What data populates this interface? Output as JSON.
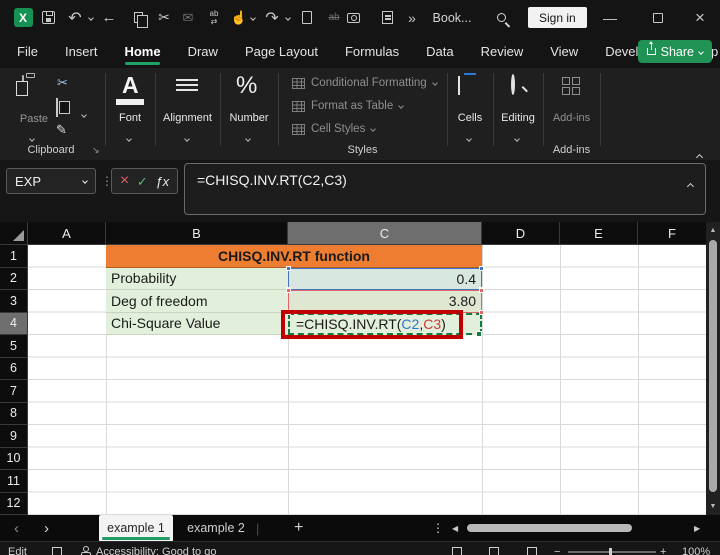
{
  "window": {
    "workbook_name": "Book...",
    "sign_in": "Sign in"
  },
  "icons": {
    "excel": "X",
    "undo": "↶",
    "back": "←",
    "cut": "✂",
    "mail": "✉",
    "replace_ab": "ab",
    "replace_arrows": "⇄",
    "touch": "☝",
    "redo": "↷",
    "strike": "ab",
    "more": "»",
    "minimize": "—",
    "close": "×",
    "dots_v": "⋮",
    "cancel": "×",
    "confirm": "✓",
    "fx": "ƒx",
    "font_a": "A",
    "percent": "%",
    "painter": "✎",
    "launcher": "↘",
    "up_triangle": "▲",
    "down_triangle": "▼",
    "left_triangle": "◀",
    "right_triangle": "▶",
    "prev_sheet": "‹",
    "next_sheet": "›",
    "add_sheet": "+",
    "tab_separator": "|",
    "zoom_minus": "−",
    "zoom_plus": "+"
  },
  "menu": {
    "tabs": [
      "File",
      "Insert",
      "Home",
      "Draw",
      "Page Layout",
      "Formulas",
      "Data",
      "Review",
      "View",
      "Developer",
      "Help"
    ],
    "active_tab": "Home",
    "share": "Share"
  },
  "ribbon": {
    "clipboard": {
      "paste": "Paste",
      "label": "Clipboard"
    },
    "font": {
      "label": "Font"
    },
    "alignment": {
      "label": "Alignment"
    },
    "number": {
      "label": "Number"
    },
    "styles": {
      "items": [
        "Conditional Formatting",
        "Format as Table",
        "Cell Styles"
      ],
      "label": "Styles"
    },
    "cells": {
      "label": "Cells"
    },
    "editing": {
      "label": "Editing"
    },
    "addins": {
      "label": "Add-ins",
      "group_label": "Add-ins"
    }
  },
  "formula_bar": {
    "name_box": "EXP",
    "formula": "=CHISQ.INV.RT(C2,C3)"
  },
  "grid": {
    "columns": [
      "A",
      "B",
      "C",
      "D",
      "E",
      "F"
    ],
    "active_column": "C",
    "rows": [
      "1",
      "2",
      "3",
      "4",
      "5",
      "6",
      "7",
      "8",
      "9",
      "10",
      "11",
      "12"
    ],
    "active_row": "4",
    "cells": {
      "title": "CHISQ.INV.RT function",
      "b2": "Probability",
      "c2": "0.4",
      "b3": "Deg of freedom",
      "c3": "3.80",
      "b4": "Chi-Square Value",
      "c4": {
        "prefix": "=CHISQ.INV.RT(",
        "arg1": "C2",
        "sep": ",",
        "arg2": "C3",
        "suffix": ")"
      }
    }
  },
  "sheet_tabs": {
    "tabs": [
      {
        "label": "example 1",
        "active": true
      },
      {
        "label": "example 2",
        "active": false
      }
    ]
  },
  "status_bar": {
    "mode": "Edit",
    "accessibility": "Accessibility: Good to go",
    "zoom": "100%"
  },
  "colors": {
    "accent_green": "#21A366",
    "header_orange": "#ED7D31",
    "cell_green": "#E2EFDA",
    "ref_blue": "#4472C4",
    "ref_red": "#E06666",
    "annotation_red": "#C00000"
  }
}
